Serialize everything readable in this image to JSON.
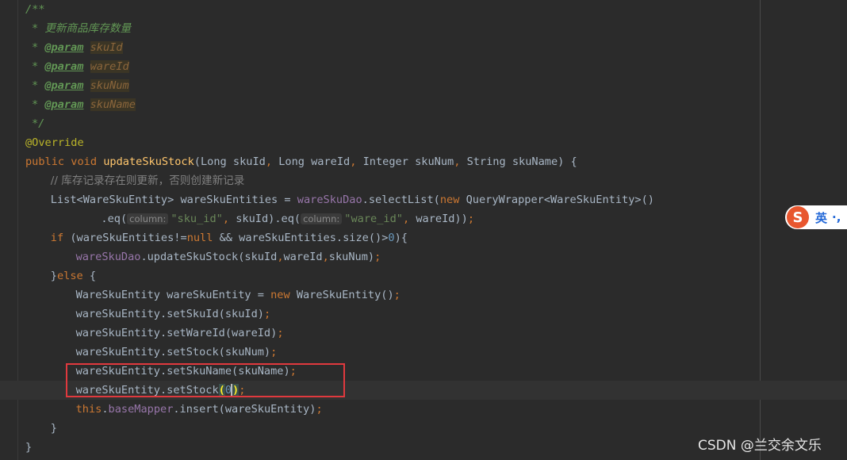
{
  "editor": {
    "lines": [
      {
        "indent": 4,
        "tokens": [
          {
            "c": "cm",
            "t": "/**"
          }
        ]
      },
      {
        "indent": 5,
        "tokens": [
          {
            "c": "cm",
            "t": "* "
          },
          {
            "c": "cm-cn",
            "t": "更新商品库存数量"
          }
        ]
      },
      {
        "indent": 5,
        "tokens": [
          {
            "c": "cm",
            "t": "* "
          },
          {
            "c": "tag",
            "t": "@param"
          },
          {
            "c": "cm",
            "t": " "
          },
          {
            "c": "pname",
            "t": "skuId"
          }
        ]
      },
      {
        "indent": 5,
        "tokens": [
          {
            "c": "cm",
            "t": "* "
          },
          {
            "c": "tag",
            "t": "@param"
          },
          {
            "c": "cm",
            "t": " "
          },
          {
            "c": "pname",
            "t": "wareId"
          }
        ]
      },
      {
        "indent": 5,
        "tokens": [
          {
            "c": "cm",
            "t": "* "
          },
          {
            "c": "tag",
            "t": "@param"
          },
          {
            "c": "cm",
            "t": " "
          },
          {
            "c": "pname",
            "t": "skuNum"
          }
        ]
      },
      {
        "indent": 5,
        "tokens": [
          {
            "c": "cm",
            "t": "* "
          },
          {
            "c": "tag",
            "t": "@param"
          },
          {
            "c": "cm",
            "t": " "
          },
          {
            "c": "pname",
            "t": "skuName"
          }
        ]
      },
      {
        "indent": 5,
        "tokens": [
          {
            "c": "cm",
            "t": "*/"
          }
        ]
      },
      {
        "indent": 4,
        "tokens": [
          {
            "c": "ann",
            "t": "@Override"
          }
        ]
      },
      {
        "indent": 4,
        "tokens": [
          {
            "c": "kw",
            "t": "public void "
          },
          {
            "c": "fn",
            "t": "updateSkuStock"
          },
          {
            "c": "",
            "t": "(Long skuId"
          },
          {
            "c": "kw",
            "t": ", "
          },
          {
            "c": "",
            "t": "Long wareId"
          },
          {
            "c": "kw",
            "t": ", "
          },
          {
            "c": "",
            "t": "Integer skuNum"
          },
          {
            "c": "kw",
            "t": ", "
          },
          {
            "c": "",
            "t": "String skuName) {"
          }
        ]
      },
      {
        "indent": 8,
        "tokens": [
          {
            "c": "line-cn",
            "t": "// 库存记录存在则更新，否则创建新记录"
          }
        ]
      },
      {
        "indent": 8,
        "tokens": [
          {
            "c": "",
            "t": "List<WareSkuEntity> wareSkuEntities = "
          },
          {
            "c": "field",
            "t": "wareSkuDao"
          },
          {
            "c": "",
            "t": ".selectList("
          },
          {
            "c": "kw",
            "t": "new "
          },
          {
            "c": "",
            "t": "QueryWrapper<WareSkuEntity>()"
          }
        ]
      },
      {
        "indent": 16,
        "tokens": [
          {
            "c": "",
            "t": ".eq("
          },
          {
            "c": "hint",
            "t": "column:"
          },
          {
            "c": "str",
            "t": "\"sku_id\""
          },
          {
            "c": "kw",
            "t": ", "
          },
          {
            "c": "",
            "t": "skuId).eq("
          },
          {
            "c": "hint",
            "t": "column:"
          },
          {
            "c": "str",
            "t": "\"ware_id\""
          },
          {
            "c": "kw",
            "t": ", "
          },
          {
            "c": "",
            "t": "wareId))"
          },
          {
            "c": "kw",
            "t": ";"
          }
        ]
      },
      {
        "indent": 8,
        "tokens": [
          {
            "c": "kw",
            "t": "if "
          },
          {
            "c": "",
            "t": "(wareSkuEntities!="
          },
          {
            "c": "kw",
            "t": "null "
          },
          {
            "c": "",
            "t": "&& wareSkuEntities.size()>"
          },
          {
            "c": "num",
            "t": "0"
          },
          {
            "c": "",
            "t": "){"
          }
        ]
      },
      {
        "indent": 12,
        "tokens": [
          {
            "c": "field",
            "t": "wareSkuDao"
          },
          {
            "c": "",
            "t": ".updateSkuStock(skuId"
          },
          {
            "c": "kw",
            "t": ","
          },
          {
            "c": "",
            "t": "wareId"
          },
          {
            "c": "kw",
            "t": ","
          },
          {
            "c": "",
            "t": "skuNum)"
          },
          {
            "c": "kw",
            "t": ";"
          }
        ]
      },
      {
        "indent": 8,
        "tokens": [
          {
            "c": "",
            "t": "}"
          },
          {
            "c": "kw",
            "t": "else "
          },
          {
            "c": "",
            "t": "{"
          }
        ]
      },
      {
        "indent": 12,
        "tokens": [
          {
            "c": "",
            "t": "WareSkuEntity wareSkuEntity = "
          },
          {
            "c": "kw",
            "t": "new "
          },
          {
            "c": "",
            "t": "WareSkuEntity()"
          },
          {
            "c": "kw",
            "t": ";"
          }
        ]
      },
      {
        "indent": 12,
        "tokens": [
          {
            "c": "",
            "t": "wareSkuEntity.setSkuId(skuId)"
          },
          {
            "c": "kw",
            "t": ";"
          }
        ]
      },
      {
        "indent": 12,
        "tokens": [
          {
            "c": "",
            "t": "wareSkuEntity.setWareId(wareId)"
          },
          {
            "c": "kw",
            "t": ";"
          }
        ]
      },
      {
        "indent": 12,
        "tokens": [
          {
            "c": "",
            "t": "wareSkuEntity.setStock(skuNum)"
          },
          {
            "c": "kw",
            "t": ";"
          }
        ]
      },
      {
        "indent": 12,
        "tokens": [
          {
            "c": "",
            "t": "wareSkuEntity.setSkuName(skuName)"
          },
          {
            "c": "kw",
            "t": ";"
          }
        ]
      },
      {
        "indent": 12,
        "tokens": [
          {
            "c": "",
            "t": "wareSkuEntity.setStock"
          },
          {
            "c": "brace-match",
            "t": "("
          },
          {
            "c": "num",
            "t": "0"
          },
          {
            "c": "caret",
            "t": ""
          },
          {
            "c": "brace-match",
            "t": ")"
          },
          {
            "c": "kw",
            "t": ";"
          }
        ]
      },
      {
        "indent": 12,
        "tokens": [
          {
            "c": "kw",
            "t": "this"
          },
          {
            "c": "",
            "t": "."
          },
          {
            "c": "field",
            "t": "baseMapper"
          },
          {
            "c": "",
            "t": ".insert(wareSkuEntity)"
          },
          {
            "c": "kw",
            "t": ";"
          }
        ]
      },
      {
        "indent": 8,
        "tokens": [
          {
            "c": "",
            "t": "}"
          }
        ]
      },
      {
        "indent": 4,
        "tokens": [
          {
            "c": "",
            "t": "}"
          }
        ]
      }
    ]
  },
  "ime": {
    "logo": "S",
    "language": "英",
    "punct": "·,"
  },
  "watermark": "CSDN @兰交余文乐"
}
